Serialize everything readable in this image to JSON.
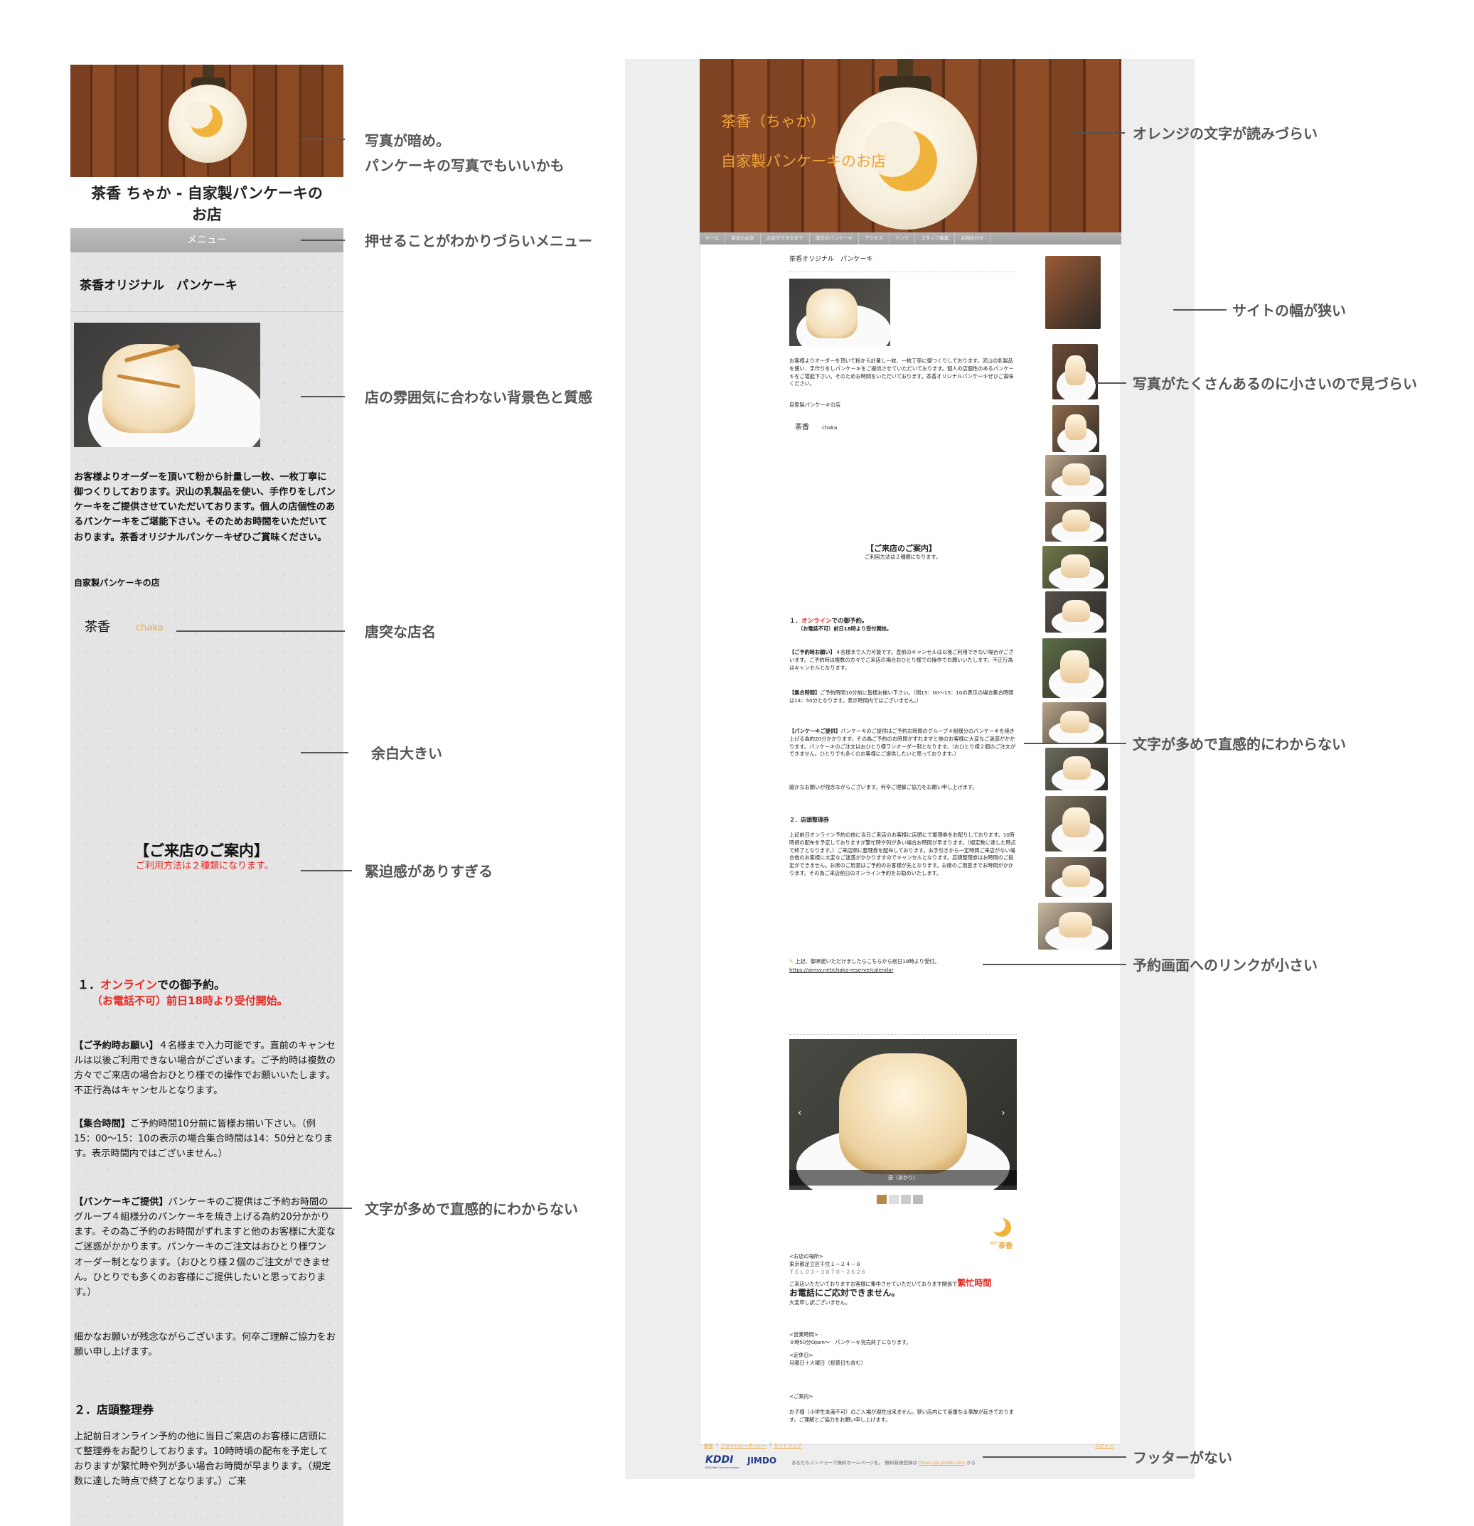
{
  "annotations": [
    {
      "id": "dark-photo",
      "lines": [
        "写真が暗め。",
        "パンケーキの写真でもいいかも"
      ]
    },
    {
      "id": "menu",
      "lines": [
        "押せることがわかりづらいメニュー"
      ]
    },
    {
      "id": "bg",
      "lines": [
        "店の雰囲気に合わない背景色と質感"
      ]
    },
    {
      "id": "shopname",
      "lines": [
        "唐突な店名"
      ]
    },
    {
      "id": "whitespace",
      "lines": [
        "余白大きい"
      ]
    },
    {
      "id": "urgent",
      "lines": [
        "緊迫感がありすぎる"
      ]
    },
    {
      "id": "text-left",
      "lines": [
        "文字が多めで直感的にわからない"
      ]
    },
    {
      "id": "orange",
      "lines": [
        "オレンジの文字が読みづらい"
      ]
    },
    {
      "id": "narrow",
      "lines": [
        "サイトの幅が狭い"
      ]
    },
    {
      "id": "photos",
      "lines": [
        "写真がたくさんあるのに小さいので見づらい"
      ]
    },
    {
      "id": "text-right",
      "lines": [
        "文字が多めで直感的にわからない"
      ]
    },
    {
      "id": "link",
      "lines": [
        "予約画面へのリンクが小さい"
      ]
    },
    {
      "id": "footer",
      "lines": [
        "フッターがない"
      ]
    }
  ],
  "mobile": {
    "site_title": "茶香 ちゃか - 自家製パンケーキの お店",
    "menu_label": "メニュー",
    "heading": "茶香オリジナル　パンケーキ",
    "intro": "お客様よりオーダーを頂いて粉から計量し一枚、一枚丁寧に御つくりしております。沢山の乳製品を使い、手作りをしパンケーキをご提供させていただいております。個人の店個性のあるパンケーキをご堪能下さい。そのためお時間をいただいております。茶香オリジナルパンケーキぜひご賞味ください。",
    "subtitle": "自家製パンケーキの店",
    "shop_name": "茶香",
    "shop_name_en": "chaka",
    "guide_title": "【ご来店のご案内】",
    "guide_sub": "ご利用方法は２種類になります。",
    "sec1_prefix": "１．",
    "sec1_online": "オンライン",
    "sec1_rest": "での御予約。",
    "sec1_note": "（お電話不可）前日18時より受付開始。",
    "p1_label": "【ご予約時お願い】",
    "p1": "４名様まで入力可能です。直前のキャンセルは以後ご利用できない場合がございます。ご予約時は複数の方々でご来店の場合おひとり様での操作でお願いいたします。不正行為はキャンセルとなります。",
    "p2_label": "【集合時間】",
    "p2": "ご予約時間10分前に皆様お揃い下さい。（例15：00〜15：10の表示の場合集合時間は14：50分となります。表示時間内ではございません。）",
    "p3_label": "【パンケーキご提供】",
    "p3": "パンケーキのご提供はご予約お時間のグループ４組様分のパンケーキを焼き上げる為約20分かかります。その為ご予約のお時間がずれますと他のお客様に大変なご迷惑がかかります。パンケーキのご注文はおひとり様ワンオーダー制となります。（おひとり様２個のご注文ができません。ひとりでも多くのお客様にご提供したいと思っております。）",
    "p4": "細かなお願いが残念ながらございます。何卒ご理解ご協力をお願い申し上げます。",
    "sec2": "２．店頭整理券",
    "p5": "上記前日オンライン予約の他に当日ご来店のお客様に店頭にて整理券をお配りしております。10時時頃の配布を予定しておりますが繁忙時や列が多い場合お時間が早まります。（規定数に達した時点で終了となります。）ご来"
  },
  "desktop": {
    "header_line1": "茶香（ちゃか）",
    "header_line2": "自家製パンケーキのお店",
    "nav": [
      "ホーム",
      "茶香の由来",
      "お店ができるまで",
      "過去のパンケーキ",
      "アクセス",
      "リンク",
      "スタッフ募集",
      "お問合わせ"
    ],
    "heading": "茶香オリジナル　パンケーキ",
    "intro": "お客様よりオーダーを頂いて粉から計量し一枚、一枚丁寧に御つくりしております。沢山の乳製品を使い、手作りをしパンケーキをご提供させていただいております。個人の店個性のあるパンケーキをご堪能下さい。そのためお時間をいただいております。茶香オリジナルパンケーキぜひご賞味ください。",
    "subtitle": "自家製パンケーキの店",
    "shop_name": "茶香",
    "shop_name_en": "chaka",
    "guide_title": "【ご来店のご案内】",
    "guide_sub": "ご利用方法は２種類になります。",
    "sec1_prefix": "１．",
    "sec1_online": "オンライン",
    "sec1_rest": "での御予約。",
    "sec1_note": "（お電話不可）前日18時より受付開始。",
    "p1_label": "【ご予約時お願い】",
    "p1": "４名様まで入力可能です。直前のキャンセルは以後ご利用できない場合がございます。ご予約時は複数の方々でご来店の場合おひとり様での操作でお願いいたします。不正行為はキャンセルとなります。",
    "p2_label": "【集合時間】",
    "p2": "ご予約時間10分前に皆様お揃い下さい。（例15：00〜15：10の表示の場合集合時間は14：50分となります。表示時間内ではございません。）",
    "p3_label": "【パンケーキご提供】",
    "p3": "パンケーキのご提供はご予約お時間のグループ４組様分のパンケーキを焼き上げる為約20分かかります。その為ご予約のお時間がずれますと他のお客様に大変なご迷惑がかかります。パンケーキのご注文はおひとり様ワンオーダー制となります。（おひとり様２個のご注文ができません。ひとりでも多くのお客様にご提供したいと思っております。）",
    "p4": "細かなお願いが残念ながらございます。何卒ご理解ご協力をお願い申し上げます。",
    "sec2": "２．店頭整理券",
    "p5": "上記前日オンライン予約の他に当日ご来店のお客様に店頭にて整理券をお配りしております。10時時頃の配布を予定しておりますが繁忙時や列が多い場合お時間が早まります。（規定数に達した時点で終了となります。）ご来店順に整理券を配布しております。お手引きから一定時間ご来店がない場合他のお客様に大変なご迷惑がかかりますのでキャンセルとなります。店頭整理券はお時間のご指定ができません。お席のご用意はご予約のお客様が先となります。お席のご用意までお時間がかかります。その為ご来店前日のオンライン予約をお勧めいたします。",
    "reserve_text": "上記、御承諾いただけましたらこちらから前日18時より受付。",
    "reserve_link": "https://airrsv.net/chaka-reserve/calendar",
    "slide_caption": "昼（あかり）",
    "logo_text": "茶香",
    "logo_small": "珈琲",
    "addr_label": "<お店の場所>",
    "addr": "東京都足立区千住１－２４－８",
    "tel": "ＴＥＬ０３－３８７０－２６２６",
    "busy_pre": "ご来店いただいておりますお客様に集中させていただいております関係で",
    "busy_red1": "繁忙時間",
    "busy_red2": "お電話にご応対できません。",
    "busy_after": "大変申し訳ございません。",
    "hours_label": "<営業時間>",
    "hours": "９時50分Open～　パンケーキ完売終了になります。",
    "closed_label": "<定休日>",
    "closed": "月曜日＋火曜日（祝祭日も含む）",
    "notice_label": "<ご案内>",
    "notice": "お子様（小学生未満不可）のご入場が現在出来ません。狭い店内にて度重なる事故が起きております。ご理解とご協力をお願い申し上げます。",
    "footer_links": [
      "概要",
      "プライバシーポリシー",
      "サイトマップ"
    ],
    "footer_login": "ログイン",
    "footer_brand1": "KDDI",
    "footer_brand1_sub": "KDDI Web Communications",
    "footer_brand2": "JIMDO",
    "footer_text": "あなたもジンドゥーで無料ホームページを。 無料新規登録は",
    "footer_url": "https://jp.jimdo.com",
    "footer_suffix": "から"
  },
  "colors": {
    "accent_orange": "#f0a437",
    "alert_red": "#e8261f",
    "annotation_gray": "#555555"
  }
}
